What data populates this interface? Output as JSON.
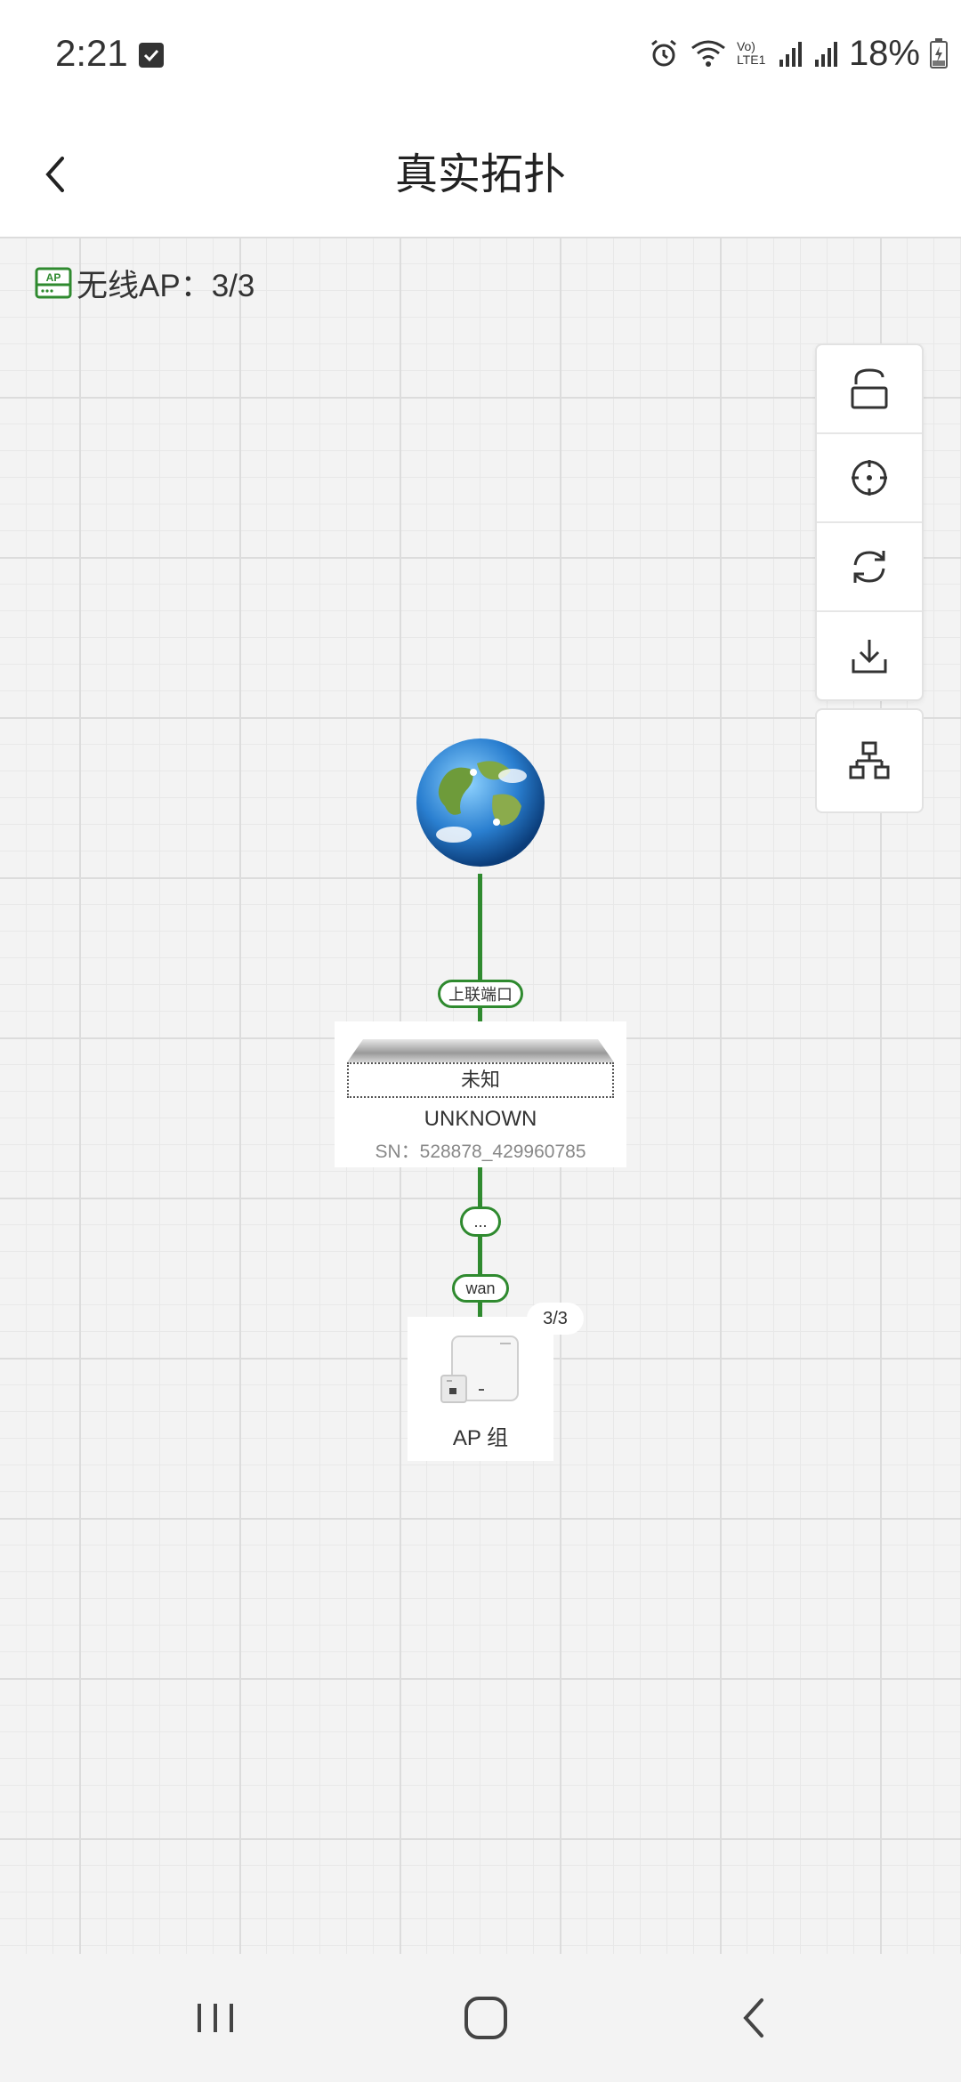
{
  "status_bar": {
    "time": "2:21",
    "battery_percent": "18%",
    "network_label": "Vo) LTE1"
  },
  "header": {
    "title": "真实拓扑"
  },
  "summary": {
    "ap_count_text": "无线AP：3/3",
    "ap_icon_text": "AP"
  },
  "toolbar": {
    "items": [
      "unlock-icon",
      "locate-icon",
      "refresh-icon",
      "download-icon"
    ],
    "layout_button": "topology-layout-icon"
  },
  "topology": {
    "uplink_label": "上联端口",
    "switch": {
      "name": "未知",
      "model": "UNKNOWN",
      "sn": "SN：528878_429960785"
    },
    "middle_label": "...",
    "wan_label": "wan",
    "ap_group": {
      "label": "AP 组",
      "badge": "3/3"
    }
  },
  "colors": {
    "link_green": "#2f8a2f",
    "background": "#f3f3f3"
  }
}
